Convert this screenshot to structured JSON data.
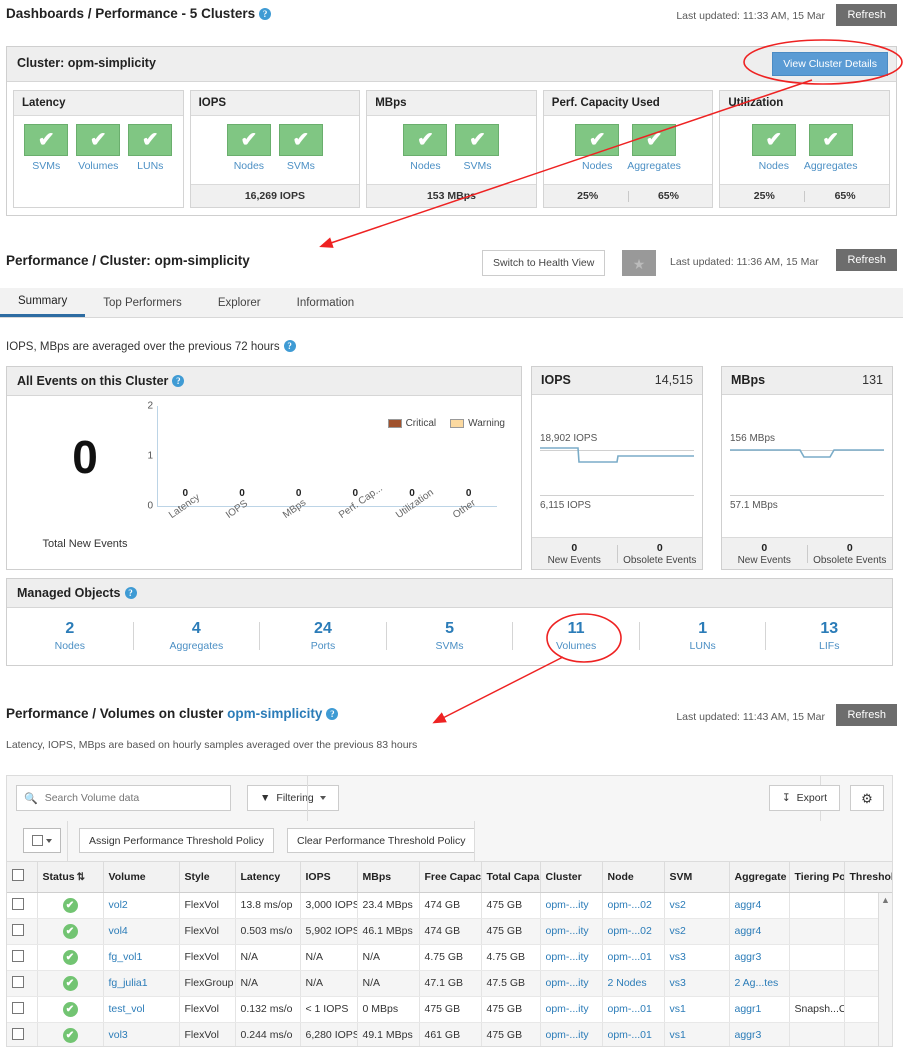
{
  "topbar": {
    "title": "Dashboards / Performance - 5 Clusters",
    "last_updated": "Last updated: 11:33 AM, 15 Mar",
    "refresh_label": "Refresh"
  },
  "cluster_panel": {
    "title": "Cluster: opm-simplicity",
    "view_details_label": "View Cluster Details",
    "cards": [
      {
        "title": "Latency",
        "metrics": [
          {
            "label": "SVMs"
          },
          {
            "label": "Volumes"
          },
          {
            "label": "LUNs"
          }
        ],
        "footer": []
      },
      {
        "title": "IOPS",
        "metrics": [
          {
            "label": "Nodes"
          },
          {
            "label": "SVMs"
          }
        ],
        "footer": [
          "16,269 IOPS"
        ]
      },
      {
        "title": "MBps",
        "metrics": [
          {
            "label": "Nodes"
          },
          {
            "label": "SVMs"
          }
        ],
        "footer": [
          "153 MBps"
        ]
      },
      {
        "title": "Perf. Capacity Used",
        "metrics": [
          {
            "label": "Nodes"
          },
          {
            "label": "Aggregates"
          }
        ],
        "footer": [
          "25%",
          "65%"
        ]
      },
      {
        "title": "Utilization",
        "metrics": [
          {
            "label": "Nodes"
          },
          {
            "label": "Aggregates"
          }
        ],
        "footer": [
          "25%",
          "65%"
        ]
      }
    ]
  },
  "perf_header": {
    "title": "Performance / Cluster: opm-simplicity",
    "switch_label": "Switch to Health View",
    "star_glyph": "★",
    "last_updated": "Last updated: 11:36 AM, 15 Mar",
    "refresh_label": "Refresh"
  },
  "tabs": [
    {
      "label": "Summary",
      "active": true
    },
    {
      "label": "Top Performers",
      "active": false
    },
    {
      "label": "Explorer",
      "active": false
    },
    {
      "label": "Information",
      "active": false
    }
  ],
  "summary_note": "IOPS, MBps are averaged over the previous 72 hours",
  "events_panel": {
    "title": "All Events on this Cluster",
    "total_value": "0",
    "total_label": "Total New Events"
  },
  "chart_data": {
    "type": "bar",
    "title": "All Events on this Cluster",
    "categories": [
      "Latency",
      "IOPS",
      "MBps",
      "Perf. Cap...",
      "Utilization",
      "Other"
    ],
    "series": [
      {
        "name": "Critical",
        "color": "#a0522d",
        "values": [
          0,
          0,
          0,
          0,
          0,
          0
        ]
      },
      {
        "name": "Warning",
        "color": "#fbd9a0",
        "values": [
          0,
          0,
          0,
          0,
          0,
          0
        ]
      }
    ],
    "bar_labels": [
      "0",
      "0",
      "0",
      "0",
      "0",
      "0"
    ],
    "yticks": [
      "0",
      "1",
      "2"
    ],
    "ylim": [
      0,
      2
    ],
    "xlabel": "",
    "ylabel": "",
    "grid": false,
    "legend_position": "top-right",
    "legend": [
      "Critical",
      "Warning"
    ]
  },
  "mini_panels": [
    {
      "title": "IOPS",
      "value": "14,515",
      "upper_label": "18,902 IOPS",
      "lower_label": "6,115 IOPS",
      "new_events": "0",
      "new_events_label": "New Events",
      "obsolete_events": "0",
      "obsolete_events_label": "Obsolete Events"
    },
    {
      "title": "MBps",
      "value": "131",
      "upper_label": "156 MBps",
      "lower_label": "57.1 MBps",
      "new_events": "0",
      "new_events_label": "New Events",
      "obsolete_events": "0",
      "obsolete_events_label": "Obsolete Events"
    }
  ],
  "managed_objects": {
    "title": "Managed Objects",
    "items": [
      {
        "count": "2",
        "label": "Nodes"
      },
      {
        "count": "4",
        "label": "Aggregates"
      },
      {
        "count": "24",
        "label": "Ports"
      },
      {
        "count": "5",
        "label": "SVMs"
      },
      {
        "count": "11",
        "label": "Volumes"
      },
      {
        "count": "1",
        "label": "LUNs"
      },
      {
        "count": "13",
        "label": "LIFs"
      }
    ]
  },
  "volumes_header": {
    "title_prefix": "Performance / Volumes on cluster ",
    "cluster_name": "opm-simplicity",
    "last_updated": "Last updated: 11:43 AM, 15 Mar",
    "refresh_label": "Refresh",
    "subtitle": "Latency, IOPS, MBps are based on hourly samples averaged over the previous 83 hours"
  },
  "table_toolbar": {
    "search_placeholder": "Search Volume data",
    "search_value": "",
    "filtering_label": "Filtering",
    "export_label": "Export",
    "gear_glyph": "⚙"
  },
  "table_actions": {
    "assign_policy_label": "Assign Performance Threshold Policy",
    "clear_policy_label": "Clear Performance Threshold Policy"
  },
  "table": {
    "columns": [
      "",
      "Status",
      "Volume",
      "Style",
      "Latency",
      "IOPS",
      "MBps",
      "Free Capac",
      "Total Capa",
      "Cluster",
      "Node",
      "SVM",
      "Aggregate",
      "Tiering Polic",
      "Threshold"
    ],
    "sort_column": "Status",
    "sort_glyph": "⇅",
    "rows": [
      {
        "status": "ok",
        "volume": "vol2",
        "style": "FlexVol",
        "latency": "13.8 ms/op",
        "iops": "3,000 IOPS",
        "mbps": "23.4 MBps",
        "free": "474 GB",
        "total": "475 GB",
        "cluster": "opm-...ity",
        "node": "opm-...02",
        "svm": "vs2",
        "aggregate": "aggr4",
        "tiering": "",
        "threshold": ""
      },
      {
        "status": "ok",
        "volume": "vol4",
        "style": "FlexVol",
        "latency": "0.503 ms/o",
        "iops": "5,902 IOPS",
        "mbps": "46.1 MBps",
        "free": "474 GB",
        "total": "475 GB",
        "cluster": "opm-...ity",
        "node": "opm-...02",
        "svm": "vs2",
        "aggregate": "aggr4",
        "tiering": "",
        "threshold": ""
      },
      {
        "status": "ok",
        "volume": "fg_vol1",
        "style": "FlexVol",
        "latency": "N/A",
        "iops": "N/A",
        "mbps": "N/A",
        "free": "4.75 GB",
        "total": "4.75 GB",
        "cluster": "opm-...ity",
        "node": "opm-...01",
        "svm": "vs3",
        "aggregate": "aggr3",
        "tiering": "",
        "threshold": ""
      },
      {
        "status": "ok",
        "volume": "fg_julia1",
        "style": "FlexGroup",
        "latency": "N/A",
        "iops": "N/A",
        "mbps": "N/A",
        "free": "47.1 GB",
        "total": "47.5 GB",
        "cluster": "opm-...ity",
        "node": "2 Nodes",
        "svm": "vs3",
        "aggregate": "2 Ag...tes",
        "tiering": "",
        "threshold": ""
      },
      {
        "status": "ok",
        "volume": "test_vol",
        "style": "FlexVol",
        "latency": "0.132 ms/o",
        "iops": "< 1 IOPS",
        "mbps": "0 MBps",
        "free": "475 GB",
        "total": "475 GB",
        "cluster": "opm-...ity",
        "node": "opm-...01",
        "svm": "vs1",
        "aggregate": "aggr1",
        "tiering": "Snapsh...Only",
        "threshold": ""
      },
      {
        "status": "ok",
        "volume": "vol3",
        "style": "FlexVol",
        "latency": "0.244 ms/o",
        "iops": "6,280 IOPS",
        "mbps": "49.1 MBps",
        "free": "461 GB",
        "total": "475 GB",
        "cluster": "opm-...ity",
        "node": "opm-...01",
        "svm": "vs1",
        "aggregate": "aggr3",
        "tiering": "",
        "threshold": ""
      }
    ]
  },
  "colors": {
    "accent_blue": "#2b7cb8",
    "button_blue": "#5a9bd4",
    "status_green": "#72c472",
    "annotation_red": "#ee2222",
    "critical": "#a0522d",
    "warning": "#fbd9a0"
  }
}
